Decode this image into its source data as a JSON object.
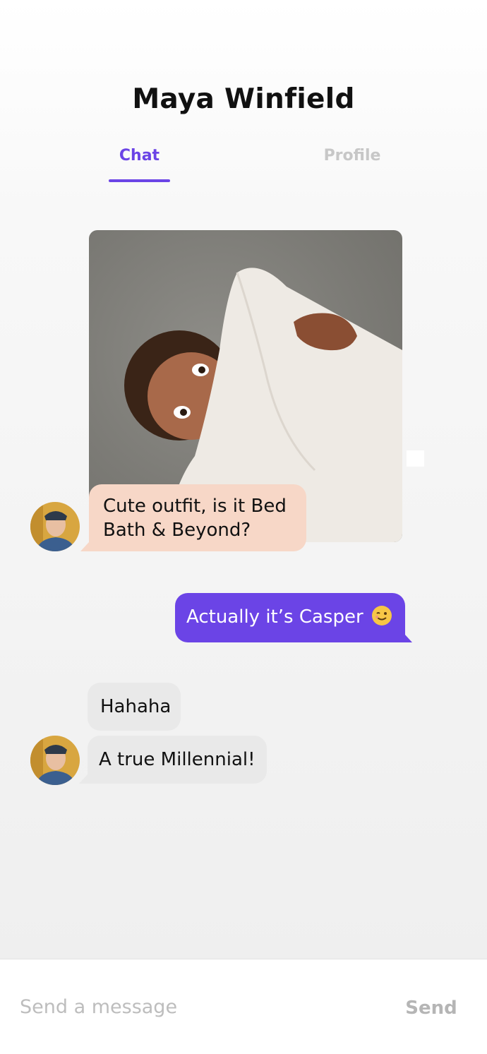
{
  "header": {
    "contact_name": "Maya Winfield",
    "tabs": [
      {
        "label": "Chat",
        "active": true
      },
      {
        "label": "Profile",
        "active": false
      }
    ]
  },
  "messages": [
    {
      "type": "image",
      "from": "contact",
      "description_icon": "shared-photo"
    },
    {
      "type": "text",
      "from": "contact",
      "text": "Cute outfit, is it Bed Bath & Beyond?"
    },
    {
      "type": "text",
      "from": "me",
      "text": "Actually it’s Casper",
      "emoji": "winking-face-icon"
    },
    {
      "type": "text",
      "from": "contact",
      "text": "Hahaha"
    },
    {
      "type": "text",
      "from": "contact",
      "text": "A true Millennial!"
    }
  ],
  "composer": {
    "placeholder": "Send a message",
    "send_label": "Send"
  },
  "colors": {
    "accent": "#6b44e6",
    "incoming_highlight": "#f7d7c7",
    "incoming_bubble": "#e9e9e9",
    "tab_inactive": "#c7c7c7"
  }
}
